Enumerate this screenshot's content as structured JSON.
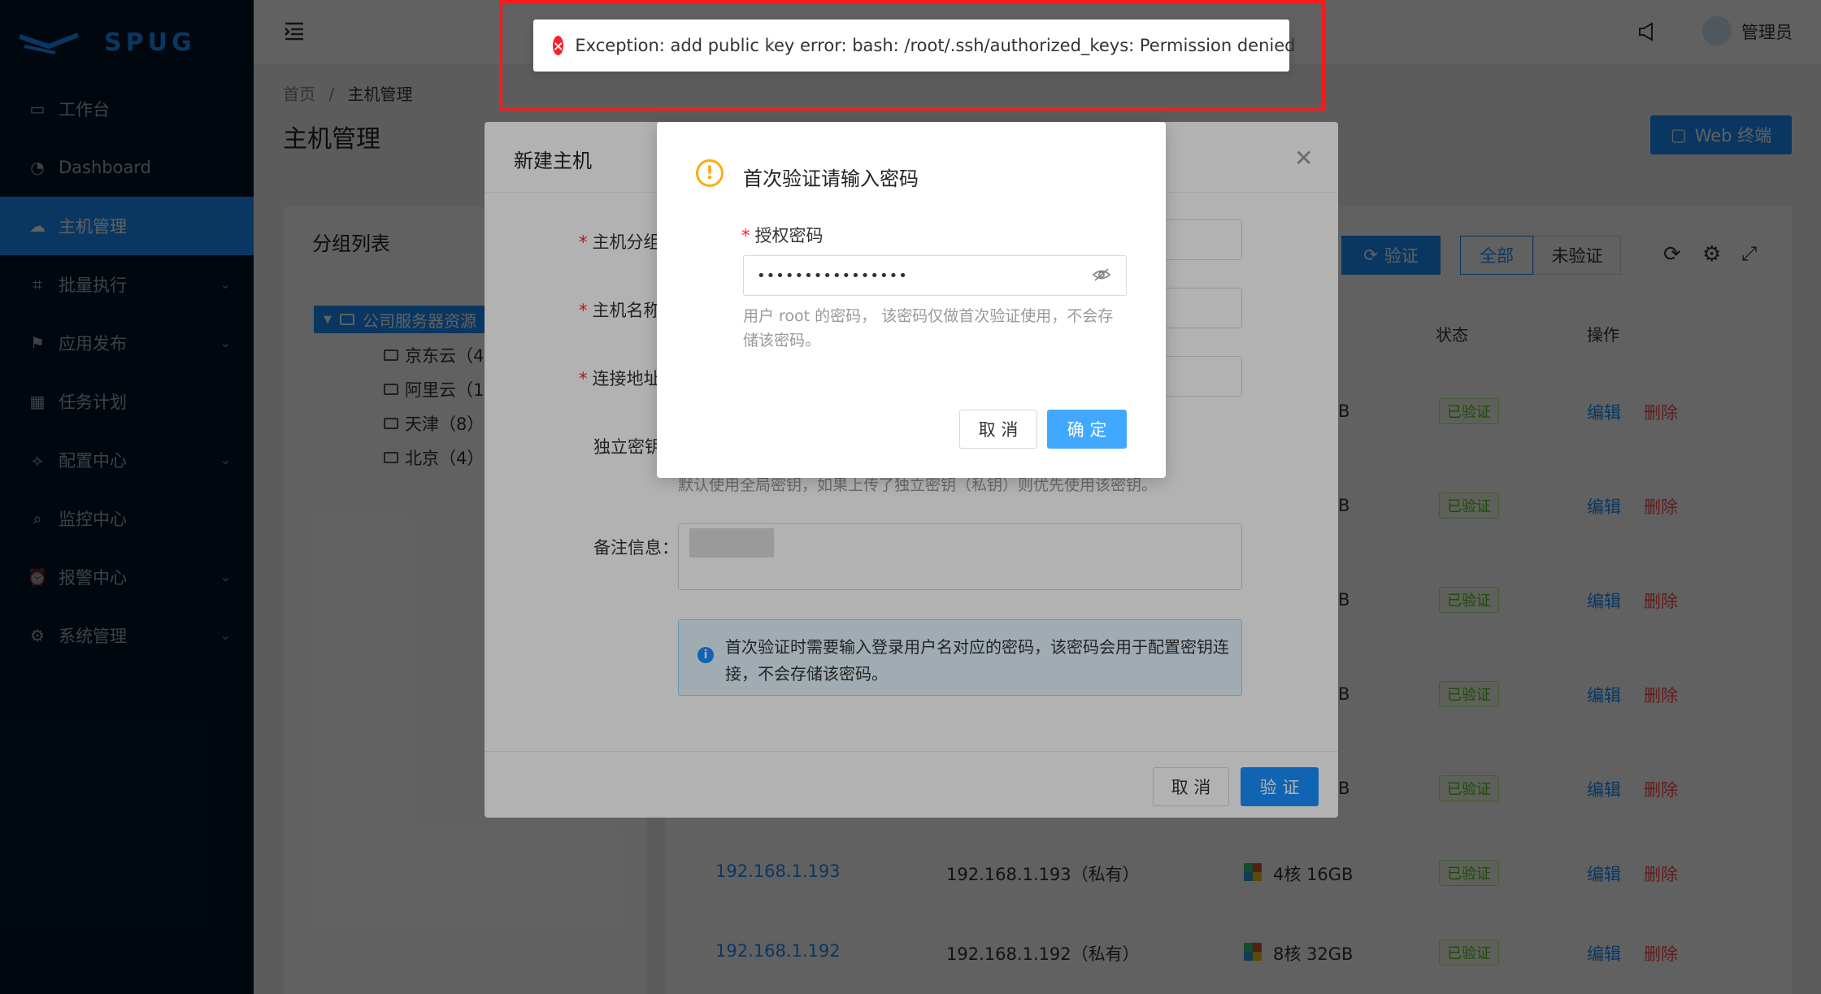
{
  "app": {
    "logo_text": "SPUG"
  },
  "sidebar": {
    "items": [
      {
        "label": "工作台",
        "icon": "desktop-icon",
        "expandable": false
      },
      {
        "label": "Dashboard",
        "icon": "dashboard-icon",
        "expandable": false
      },
      {
        "label": "主机管理",
        "icon": "cloud-server-icon",
        "expandable": false,
        "active": true
      },
      {
        "label": "批量执行",
        "icon": "code-icon",
        "expandable": true
      },
      {
        "label": "应用发布",
        "icon": "flag-icon",
        "expandable": true
      },
      {
        "label": "任务计划",
        "icon": "schedule-icon",
        "expandable": false
      },
      {
        "label": "配置中心",
        "icon": "deployment-icon",
        "expandable": true
      },
      {
        "label": "监控中心",
        "icon": "monitor-icon",
        "expandable": false
      },
      {
        "label": "报警中心",
        "icon": "alarm-icon",
        "expandable": true
      },
      {
        "label": "系统管理",
        "icon": "setting-icon",
        "expandable": true
      }
    ]
  },
  "header": {
    "user": "管理员"
  },
  "breadcrumb": {
    "home": "首页",
    "separator": "/",
    "current": "主机管理"
  },
  "page": {
    "title": "主机管理",
    "web_terminal": "Web 终端"
  },
  "tree": {
    "title": "分组列表",
    "root": "公司服务器资源",
    "nodes": [
      "京东云（4",
      "阿里云（1",
      "天津（8）",
      "北京（4）"
    ]
  },
  "toolbar": {
    "verify": "验证",
    "filter_all": "全部",
    "filter_unverified": "未验证"
  },
  "table": {
    "headers": {
      "status": "状态",
      "actions": "操作"
    },
    "partial_rows": [
      {
        "spec_tail": "B",
        "status": "已验证"
      },
      {
        "spec_tail": "B",
        "status": "已验证"
      },
      {
        "spec_tail": "B",
        "status": "已验证"
      },
      {
        "spec_tail": "B",
        "status": "已验证"
      },
      {
        "spec_tail": "B",
        "status": "已验证"
      }
    ],
    "rows": [
      {
        "name": "192.168.1.193",
        "addr": "192.168.1.193（私有）",
        "spec": "4核 16GB",
        "status": "已验证"
      },
      {
        "name": "192.168.1.192",
        "addr": "192.168.1.192（私有）",
        "spec": "8核 32GB",
        "status": "已验证"
      }
    ],
    "edit": "编辑",
    "delete": "删除"
  },
  "host_modal": {
    "title": "新建主机",
    "labels": {
      "group": "主机分组",
      "name": "主机名称",
      "address": "连接地址",
      "key": "独立密钥",
      "remark": "备注信息："
    },
    "key_hint": "默认使用全局密钥，如果上传了独立密钥（私钥）则优先使用该密钥。",
    "info": "首次验证时需要输入登录用户名对应的密码，该密码会用于配置密钥连接，不会存储该密码。",
    "cancel": "取 消",
    "submit": "验 证"
  },
  "confirm_modal": {
    "title": "首次验证请输入密码",
    "field_label": "授权密码",
    "password_mask": "••••••••••••••••",
    "hint": "用户 root 的密码， 该密码仅做首次验证使用，不会存储该密码。",
    "cancel": "取 消",
    "ok": "确 定"
  },
  "alert": {
    "message": "Exception: add public key error: bash: /root/.ssh/authorized_keys: Permission denied"
  }
}
